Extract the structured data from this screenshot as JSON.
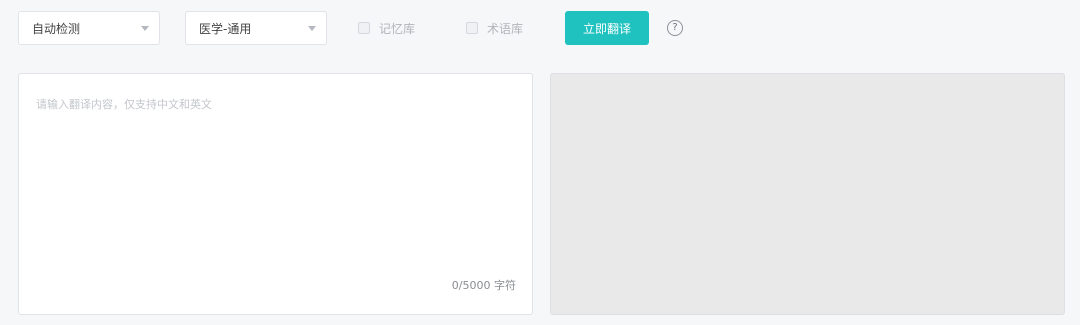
{
  "toolbar": {
    "source_language": "自动检测",
    "domain": "医学-通用",
    "memory_label": "记忆库",
    "term_label": "术语库",
    "translate_label": "立即翻译",
    "help_symbol": "?"
  },
  "source": {
    "placeholder": "请输入翻译内容，仅支持中文和英文",
    "value": "",
    "char_count": "0/5000 字符"
  },
  "target": {
    "value": ""
  },
  "colors": {
    "accent": "#1fc2bf",
    "page_background": "#f6f7f9",
    "output_background": "#e9e9ea"
  },
  "icons": {
    "dropdown": "caret-down-icon",
    "help": "question-circle-icon"
  }
}
